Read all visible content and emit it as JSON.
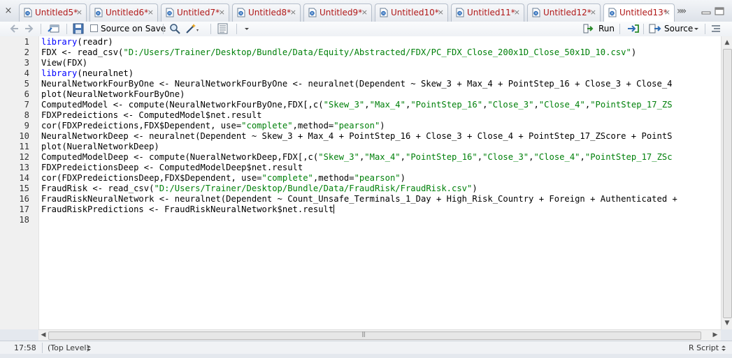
{
  "tabs": [
    {
      "label": "Untitled5*",
      "active": false
    },
    {
      "label": "Untitled6*",
      "active": false
    },
    {
      "label": "Untitled7*",
      "active": false
    },
    {
      "label": "Untitled8*",
      "active": false
    },
    {
      "label": "Untitled9*",
      "active": false
    },
    {
      "label": "Untitled10*",
      "active": false
    },
    {
      "label": "Untitled11*",
      "active": false
    },
    {
      "label": "Untitled12*",
      "active": false
    },
    {
      "label": "Untitled13*",
      "active": true
    }
  ],
  "toolbar": {
    "source_on_save_label": "Source on Save",
    "run_label": "Run",
    "source_label": "Source"
  },
  "editor": {
    "line_numbers": [
      "1",
      "2",
      "3",
      "4",
      "5",
      "6",
      "7",
      "8",
      "9",
      "10",
      "11",
      "12",
      "13",
      "14",
      "15",
      "16",
      "17",
      "18"
    ],
    "lines": [
      [
        {
          "t": "library",
          "c": "k"
        },
        {
          "t": "(readr)",
          "c": ""
        }
      ],
      [
        {
          "t": "FDX <- read_csv(",
          "c": ""
        },
        {
          "t": "\"D:/Users/Trainer/Desktop/Bundle/Data/Equity/Abstracted/FDX/PC_FDX_Close_200x1D_Close_50x1D_10.csv\"",
          "c": "s"
        },
        {
          "t": ")",
          "c": ""
        }
      ],
      [
        {
          "t": "View(FDX)",
          "c": ""
        }
      ],
      [
        {
          "t": "library",
          "c": "k"
        },
        {
          "t": "(neuralnet)",
          "c": ""
        }
      ],
      [
        {
          "t": "NeuralNetworkFourByOne <- NeuralNetworkFourByOne <- neuralnet(Dependent ~ Skew_3 + Max_4 + PointStep_16 + Close_3 + Close_4",
          "c": ""
        }
      ],
      [
        {
          "t": "plot(NeuralNetworkFourByOne)",
          "c": ""
        }
      ],
      [
        {
          "t": "ComputedModel <- compute(NeuralNetworkFourByOne,FDX[,c(",
          "c": ""
        },
        {
          "t": "\"Skew_3\"",
          "c": "s"
        },
        {
          "t": ",",
          "c": ""
        },
        {
          "t": "\"Max_4\"",
          "c": "s"
        },
        {
          "t": ",",
          "c": ""
        },
        {
          "t": "\"PointStep_16\"",
          "c": "s"
        },
        {
          "t": ",",
          "c": ""
        },
        {
          "t": "\"Close_3\"",
          "c": "s"
        },
        {
          "t": ",",
          "c": ""
        },
        {
          "t": "\"Close_4\"",
          "c": "s"
        },
        {
          "t": ",",
          "c": ""
        },
        {
          "t": "\"PointStep_17_ZS",
          "c": "s"
        }
      ],
      [
        {
          "t": "FDXPredeictions <- ComputedModel$net.result",
          "c": ""
        }
      ],
      [
        {
          "t": "cor(FDXPredeictions,FDX$Dependent, use=",
          "c": ""
        },
        {
          "t": "\"complete\"",
          "c": "s"
        },
        {
          "t": ",method=",
          "c": ""
        },
        {
          "t": "\"pearson\"",
          "c": "s"
        },
        {
          "t": ")",
          "c": ""
        }
      ],
      [
        {
          "t": "NeuralNetworkDeep <- neuralnet(Dependent ~ Skew_3 + Max_4 + PointStep_16 + Close_3 + Close_4 + PointStep_17_ZScore + PointS",
          "c": ""
        }
      ],
      [
        {
          "t": "plot(NueralNetworkDeep)",
          "c": ""
        }
      ],
      [
        {
          "t": "ComputedModelDeep <- compute(NueralNetworkDeep,FDX[,c(",
          "c": ""
        },
        {
          "t": "\"Skew_3\"",
          "c": "s"
        },
        {
          "t": ",",
          "c": ""
        },
        {
          "t": "\"Max_4\"",
          "c": "s"
        },
        {
          "t": ",",
          "c": ""
        },
        {
          "t": "\"PointStep_16\"",
          "c": "s"
        },
        {
          "t": ",",
          "c": ""
        },
        {
          "t": "\"Close_3\"",
          "c": "s"
        },
        {
          "t": ",",
          "c": ""
        },
        {
          "t": "\"Close_4\"",
          "c": "s"
        },
        {
          "t": ",",
          "c": ""
        },
        {
          "t": "\"PointStep_17_ZSc",
          "c": "s"
        }
      ],
      [
        {
          "t": "FDXPredeictionsDeep <- ComputedModelDeep$net.result",
          "c": ""
        }
      ],
      [
        {
          "t": "cor(FDXPredeictionsDeep,FDX$Dependent, use=",
          "c": ""
        },
        {
          "t": "\"complete\"",
          "c": "s"
        },
        {
          "t": ",method=",
          "c": ""
        },
        {
          "t": "\"pearson\"",
          "c": "s"
        },
        {
          "t": ")",
          "c": ""
        }
      ],
      [
        {
          "t": "FraudRisk <- read_csv(",
          "c": ""
        },
        {
          "t": "\"D:/Users/Trainer/Desktop/Bundle/Data/FraudRisk/FraudRisk.csv\"",
          "c": "s"
        },
        {
          "t": ")",
          "c": ""
        }
      ],
      [
        {
          "t": "FraudRiskNeuralNetwork <- neuralnet(Dependent ~ Count_Unsafe_Terminals_1_Day + High_Risk_Country + Foreign + Authenticated +",
          "c": ""
        }
      ],
      [
        {
          "t": "FraudRiskPredictions <- FraudRiskNeuralNetwork$net.result",
          "c": ""
        }
      ],
      []
    ]
  },
  "status": {
    "position": "17:58",
    "scope": "(Top Level)",
    "file_type": "R Script"
  },
  "icons": {
    "tab_file": "r-script-icon",
    "back": "back-arrow-icon",
    "forward": "forward-arrow-icon",
    "show_in_window": "show-in-window-icon",
    "save": "save-icon",
    "search": "search-icon",
    "wand": "code-tools-wand-icon",
    "outline": "document-outline-icon",
    "run": "run-arrow-icon",
    "rerun": "rerun-icon",
    "source": "source-icon",
    "menu": "menu-lines-icon"
  },
  "colors": {
    "tab_label": "#b01818",
    "keyword": "#0000ff",
    "string": "#00800a"
  }
}
